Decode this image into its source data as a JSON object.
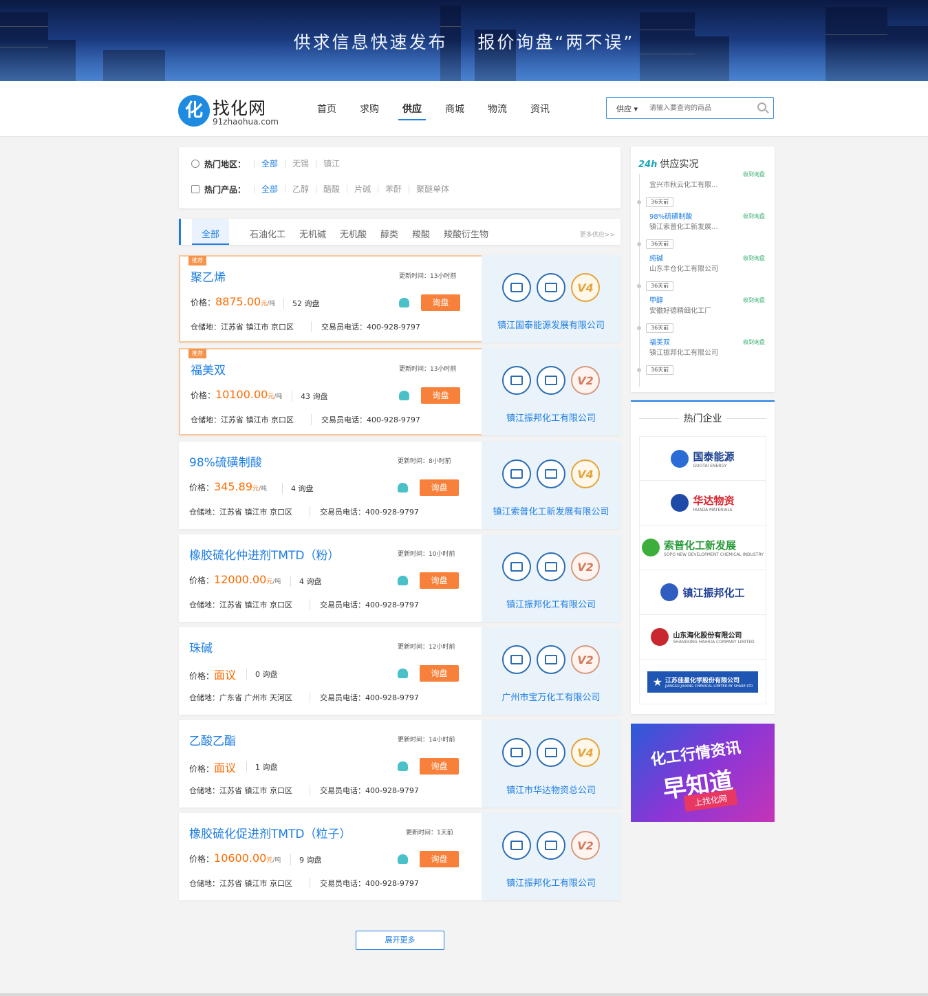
{
  "banner": {
    "slogan": "供求信息快速发布    报价询盘“两不误”"
  },
  "logo": {
    "mark": "化",
    "name": "找化网",
    "url": "91zhaohua.com"
  },
  "nav": [
    {
      "label": "首页"
    },
    {
      "label": "求购"
    },
    {
      "label": "供应",
      "active": true
    },
    {
      "label": "商城"
    },
    {
      "label": "物流"
    },
    {
      "label": "资讯"
    }
  ],
  "search": {
    "category": "供应",
    "placeholder": "请输入要查询的商品"
  },
  "filters": {
    "region": {
      "label": "热门地区：",
      "options": [
        "全部",
        "无锡",
        "镇江"
      ]
    },
    "product": {
      "label": "热门产品：",
      "options": [
        "全部",
        "乙醇",
        "醋酸",
        "片碱",
        "苯酐",
        "聚醚单体"
      ]
    }
  },
  "tabs": [
    "全部",
    "石油化工",
    "无机碱",
    "无机酸",
    "醇类",
    "羧酸",
    "羧酸衍生物"
  ],
  "tabs_more": "更多供应>>",
  "common": {
    "recommend": "推荐",
    "price_label": "价格：",
    "unit": "元",
    "per": "/吨",
    "inquiry_btn": "询盘",
    "location_label": "仓储地：",
    "phone_label": "交易员电话：",
    "phone": "400-928-9797"
  },
  "products": [
    {
      "title": "聚乙烯",
      "updated": "更新时间：13小时前",
      "price": "8875.00",
      "negotiable": false,
      "inquiries": "52 询盘",
      "location": "江苏省 镇江市 京口区",
      "company": "镇江国泰能源发展有限公司",
      "level": "V4",
      "recommended": true
    },
    {
      "title": "福美双",
      "updated": "更新时间：13小时前",
      "price": "10100.00",
      "negotiable": false,
      "inquiries": "43 询盘",
      "location": "江苏省 镇江市 京口区",
      "company": "镇江振邦化工有限公司",
      "level": "V2",
      "recommended": true
    },
    {
      "title": "98%硫磺制酸",
      "updated": "更新时间：8小时前",
      "price": "345.89",
      "negotiable": false,
      "inquiries": "4 询盘",
      "location": "江苏省 镇江市 京口区",
      "company": "镇江索普化工新发展有限公司",
      "level": "V4",
      "recommended": false
    },
    {
      "title": "橡胶硫化仲进剂TMTD（粉）",
      "updated": "更新时间：10小时前",
      "price": "12000.00",
      "negotiable": false,
      "inquiries": "4 询盘",
      "location": "江苏省 镇江市 京口区",
      "company": "镇江振邦化工有限公司",
      "level": "V2",
      "recommended": false
    },
    {
      "title": "珠碱",
      "updated": "更新时间：12小时前",
      "price": "面议",
      "negotiable": true,
      "inquiries": "0 询盘",
      "location": "广东省 广州市 天河区",
      "company": "广州市宝万化工有限公司",
      "level": "V2",
      "recommended": false
    },
    {
      "title": "乙酸乙酯",
      "updated": "更新时间：14小时前",
      "price": "面议",
      "negotiable": true,
      "inquiries": "1 询盘",
      "location": "江苏省 镇江市 京口区",
      "company": "镇江市华达物资总公司",
      "level": "V4",
      "recommended": false
    },
    {
      "title": "橡胶硫化促进剂TMTD（粒子）",
      "updated": "更新时间：1天前",
      "price": "10600.00",
      "negotiable": false,
      "inquiries": "9 询盘",
      "location": "江苏省 镇江市 京口区",
      "company": "镇江振邦化工有限公司",
      "level": "V2",
      "recommended": false
    }
  ],
  "realtime": {
    "badge": "24h",
    "title": "供应实况",
    "items": [
      {
        "ago": "",
        "product": "",
        "company": "宜兴市秋云化工有限...",
        "status": "收到询盘"
      },
      {
        "ago": "36天前",
        "product": "98%硫磺制酸",
        "company": "镇江索普化工新发展...",
        "status": "收到询盘"
      },
      {
        "ago": "36天前",
        "product": "纯碱",
        "company": "山东丰仓化工有限公司",
        "status": "收到询盘"
      },
      {
        "ago": "36天前",
        "product": "甲醇",
        "company": "安徽好德精细化工厂",
        "status": "收到询盘"
      },
      {
        "ago": "36天前",
        "product": "福美双",
        "company": "镇江振邦化工有限公司",
        "status": "收到询盘"
      },
      {
        "ago": "36天前",
        "product": "",
        "company": "",
        "status": ""
      }
    ]
  },
  "hot": {
    "title": "热门企业",
    "logos": [
      {
        "name": "国泰能源",
        "sub": "GUOTAI ENERGY",
        "color": "#1a3f8f",
        "sym": "#2b6cd6"
      },
      {
        "name": "华达物资",
        "sub": "HUADA MATERIALS",
        "color": "#d92530",
        "sym": "#1e4aa8"
      },
      {
        "name": "索普化工新发展",
        "sub": "SOPO NEW DEVELOPMENT CHEMICAL INDUSTRY",
        "color": "#2a9a3a",
        "sym": "#3cae3c"
      },
      {
        "name": "镇江振邦化工",
        "sub": "",
        "color": "#1f3f96",
        "sym": "#2f5ec0"
      },
      {
        "name": "山东海化股份有限公司",
        "sub": "SHANDONG HAIHUA COMPANY LIMITED",
        "color": "#222222",
        "sym": "#c8282e"
      },
      {
        "name": "江苏佳星化学股份有限公司",
        "sub": "JIANGSU JIAXING CHEMICAL LIMITED BY SHARE LTD",
        "color": "#ffffff",
        "sym": "#1f56b3"
      }
    ]
  },
  "ad": {
    "line1": "化工行情资讯",
    "line2": "早知道",
    "ribbon": "上找化网"
  },
  "more_button": "展开更多"
}
